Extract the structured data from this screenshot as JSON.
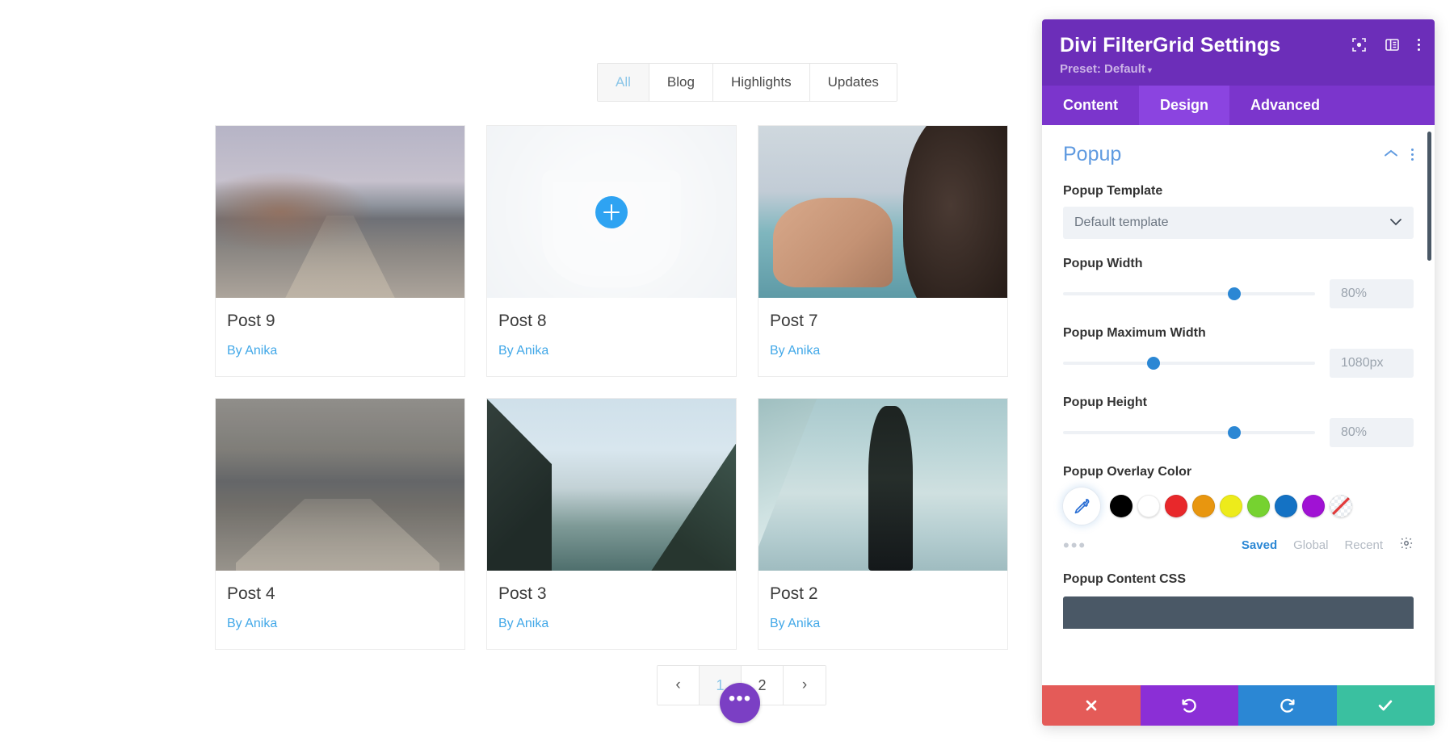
{
  "preview": {
    "filters": [
      {
        "label": "All",
        "active": true
      },
      {
        "label": "Blog",
        "active": false
      },
      {
        "label": "Highlights",
        "active": false
      },
      {
        "label": "Updates",
        "active": false
      }
    ],
    "posts": [
      {
        "title": "Post 9",
        "author": "By Anika",
        "scene": "scene-lake-pier",
        "hover": false
      },
      {
        "title": "Post 8",
        "author": "By Anika",
        "scene": "scene-binoculars",
        "hover": true
      },
      {
        "title": "Post 7",
        "author": "By Anika",
        "scene": "scene-camera-hands",
        "hover": false
      },
      {
        "title": "Post 4",
        "author": "By Anika",
        "scene": "scene-pier-dark",
        "hover": false
      },
      {
        "title": "Post 3",
        "author": "By Anika",
        "scene": "scene-lake-louise",
        "hover": false
      },
      {
        "title": "Post 2",
        "author": "By Anika",
        "scene": "scene-man-mountain",
        "hover": false
      }
    ],
    "pagination": {
      "prev": "‹",
      "next": "›",
      "pages": [
        {
          "label": "1",
          "active": true
        },
        {
          "label": "2",
          "active": false
        }
      ],
      "more_label": "•••"
    }
  },
  "panel": {
    "title": "Divi FilterGrid Settings",
    "preset_label": "Preset: Default",
    "preset_caret": "▾",
    "header_icons": [
      "focus-target-icon",
      "layout-panel-icon",
      "overflow-menu-icon"
    ],
    "tabs": [
      {
        "label": "Content",
        "active": false
      },
      {
        "label": "Design",
        "active": true
      },
      {
        "label": "Advanced",
        "active": false
      }
    ],
    "section": {
      "title": "Popup",
      "collapse_icon": "chevron-up-icon",
      "menu_icon": "overflow-menu-icon"
    },
    "fields": {
      "popup_template": {
        "label": "Popup Template",
        "value": "Default template",
        "options": [
          "Default template"
        ]
      },
      "popup_width": {
        "label": "Popup Width",
        "value": "80%",
        "knob_percent": 68
      },
      "popup_max_width": {
        "label": "Popup Maximum Width",
        "value": "1080px",
        "knob_percent": 36
      },
      "popup_height": {
        "label": "Popup Height",
        "value": "80%",
        "knob_percent": 68
      },
      "popup_overlay_color": {
        "label": "Popup Overlay Color",
        "swatches": [
          {
            "name": "black",
            "hex": "#000000"
          },
          {
            "name": "white",
            "hex": "#ffffff"
          },
          {
            "name": "red",
            "hex": "#e8282b"
          },
          {
            "name": "orange",
            "hex": "#e8960f"
          },
          {
            "name": "yellow",
            "hex": "#edeb1b"
          },
          {
            "name": "green",
            "hex": "#76d230"
          },
          {
            "name": "blue",
            "hex": "#1472c4"
          },
          {
            "name": "purple",
            "hex": "#a012d4"
          },
          {
            "name": "none",
            "hex": "none"
          }
        ],
        "more_dots": "•••",
        "tabs": [
          {
            "label": "Saved",
            "active": true
          },
          {
            "label": "Global",
            "active": false
          },
          {
            "label": "Recent",
            "active": false
          }
        ],
        "settings_icon": "gear-icon"
      },
      "popup_content_css": {
        "label": "Popup Content CSS"
      }
    },
    "footer": [
      {
        "name": "close-button",
        "icon": "x-icon"
      },
      {
        "name": "undo-button",
        "icon": "undo-arrow-icon"
      },
      {
        "name": "redo-button",
        "icon": "redo-arrow-icon"
      },
      {
        "name": "save-button",
        "icon": "check-icon"
      }
    ]
  },
  "colors": {
    "panel_header": "#6c2eb9",
    "tab_active": "#8b44e0",
    "accent_blue": "#2b87d4",
    "link_blue": "#42a8e8",
    "section_title": "#5f9ae0"
  }
}
